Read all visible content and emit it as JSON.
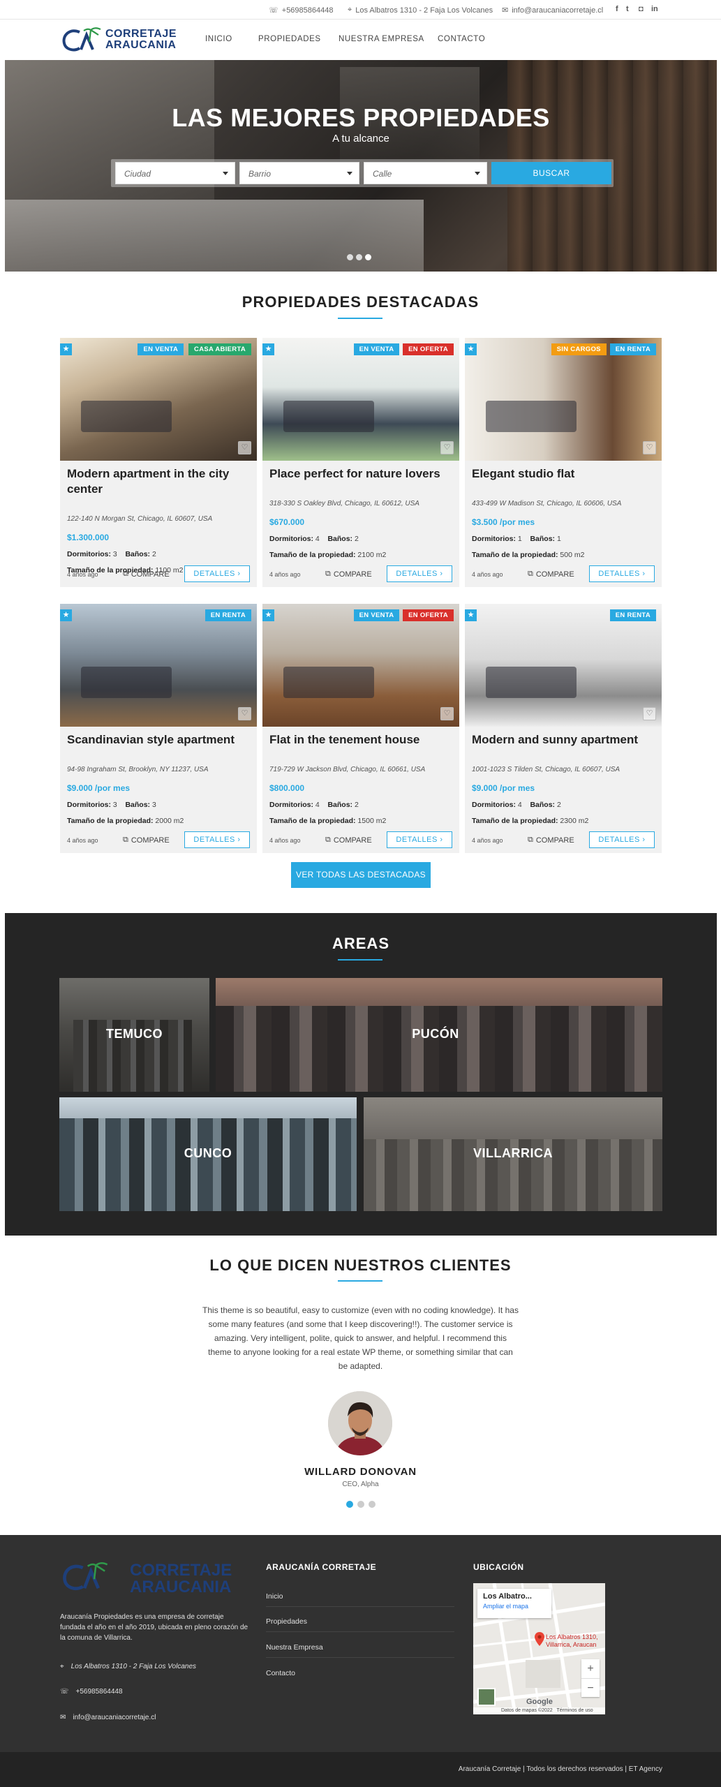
{
  "topbar": {
    "phone": "+56985864448",
    "address": "Los Albatros 1310 - 2 Faja Los Volcanes",
    "email": "info@araucaniacorretaje.cl",
    "social": [
      "f",
      "t",
      "ig",
      "in"
    ]
  },
  "brand": {
    "line1": "CORRETAJE",
    "line2": "ARAUCANIA"
  },
  "nav": [
    "INICIO",
    "PROPIEDADES",
    "NUESTRA EMPRESA",
    "CONTACTO"
  ],
  "hero": {
    "title": "LAS MEJORES PROPIEDADES",
    "subtitle": "A tu alcance",
    "city_placeholder": "Ciudad",
    "barrio_placeholder": "Barrio",
    "calle_placeholder": "Calle",
    "search_label": "BUSCAR"
  },
  "featured": {
    "title": "PROPIEDADES DESTACADAS",
    "labels": {
      "bedrooms": "Dormitorios:",
      "baths": "Baños:",
      "size": "Tamaño de la propiedad:",
      "compare": "COMPARE",
      "details": "DETALLES"
    },
    "button_all": "VER TODAS LAS DESTACADAS",
    "cards": [
      {
        "title": "Modern apartment in the city center",
        "address": "122-140 N Morgan St, Chicago, IL 60607, USA",
        "price": "$1.300.000",
        "bedrooms": "3",
        "baths": "2",
        "size": "1100 m2",
        "ago": "4 años ago",
        "badges": [
          {
            "text": "EN VENTA",
            "color": "#29a9e1"
          },
          {
            "text": "CASA ABIERTA",
            "color": "#27a86d"
          }
        ]
      },
      {
        "title": "Place perfect for nature lovers",
        "address": "318-330 S Oakley Blvd, Chicago, IL 60612, USA",
        "price": "$670.000",
        "bedrooms": "4",
        "baths": "2",
        "size": "2100 m2",
        "ago": "4 años ago",
        "badges": [
          {
            "text": "EN VENTA",
            "color": "#29a9e1"
          },
          {
            "text": "EN OFERTA",
            "color": "#d9302b"
          }
        ]
      },
      {
        "title": "Elegant studio flat",
        "address": "433-499 W Madison St, Chicago, IL 60606, USA",
        "price": "$3.500 /por mes",
        "bedrooms": "1",
        "baths": "1",
        "size": "500 m2",
        "ago": "4 años ago",
        "badges": [
          {
            "text": "SIN CARGOS",
            "color": "#f39c12"
          },
          {
            "text": "EN RENTA",
            "color": "#29a9e1"
          }
        ]
      },
      {
        "title": "Scandinavian style apartment",
        "address": "94-98 Ingraham St, Brooklyn, NY 11237, USA",
        "price": "$9.000 /por mes",
        "bedrooms": "3",
        "baths": "3",
        "size": "2000 m2",
        "ago": "4 años ago",
        "badges": [
          {
            "text": "EN RENTA",
            "color": "#29a9e1"
          }
        ]
      },
      {
        "title": "Flat in the tenement house",
        "address": "719-729 W Jackson Blvd, Chicago, IL 60661, USA",
        "price": "$800.000",
        "bedrooms": "4",
        "baths": "2",
        "size": "1500 m2",
        "ago": "4 años ago",
        "badges": [
          {
            "text": "EN VENTA",
            "color": "#29a9e1"
          },
          {
            "text": "EN OFERTA",
            "color": "#d9302b"
          }
        ]
      },
      {
        "title": "Modern and sunny apartment",
        "address": "1001-1023 S Tilden St, Chicago, IL 60607, USA",
        "price": "$9.000 /por mes",
        "bedrooms": "4",
        "baths": "2",
        "size": "2300 m2",
        "ago": "4 años ago",
        "badges": [
          {
            "text": "EN RENTA",
            "color": "#29a9e1"
          }
        ]
      }
    ]
  },
  "areas": {
    "title": "AREAS",
    "items": [
      "TEMUCO",
      "PUCÓN",
      "CUNCO",
      "VILLARRICA"
    ]
  },
  "testimonials": {
    "title": "LO QUE DICEN NUESTROS CLIENTES",
    "quote": "This theme is so beautiful, easy to customize (even with no coding knowledge). It has some many features (and some that I keep discovering!!). The customer service is amazing. Very intelligent, polite, quick to answer, and helpful. I recommend this theme to anyone looking for a real estate WP theme, or something similar that can be adapted.",
    "name": "WILLARD DONOVAN",
    "role": "CEO, Alpha"
  },
  "footer": {
    "about": "Araucanía Propiedades es una empresa de corretaje fundada el año en el año 2019, ubicada en pleno corazón de la comuna de Villarrica.",
    "address": "Los Albatros 1310 - 2 Faja Los Volcanes",
    "phone": "+56985864448",
    "email": "info@araucaniacorretaje.cl",
    "menu_title": "ARAUCANÍA CORRETAJE",
    "menu": [
      "Inicio",
      "Propiedades",
      "Nuestra Empresa",
      "Contacto"
    ],
    "map_title": "UBICACIÓN",
    "map_card_title": "Los Albatro...",
    "map_card_link": "Ampliar el mapa",
    "map_pin_label": "Los Albatros 1310, Villarrica, Araucan",
    "map_footer": "Datos de mapas ©2022",
    "map_terms": "Términos de uso",
    "google": "Google",
    "copyright": "Araucanía Corretaje | Todos los derechos reservados | ET Agency"
  }
}
